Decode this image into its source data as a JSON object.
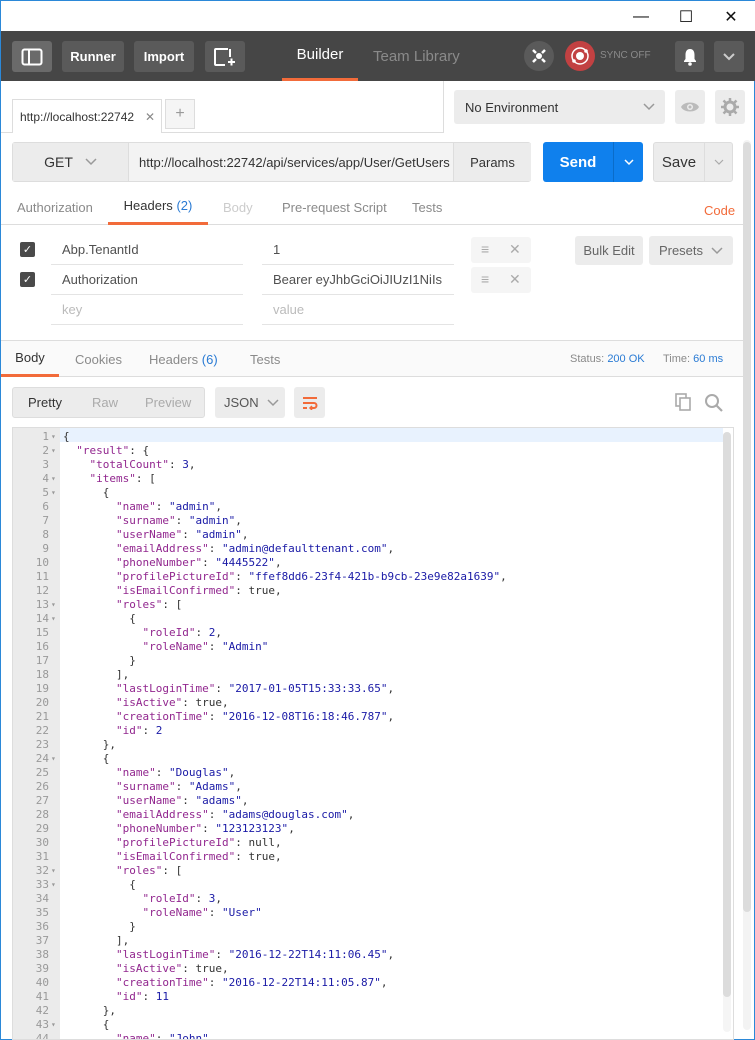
{
  "window": {
    "minimize": "—",
    "maximize": "☐",
    "close": "✕"
  },
  "toolbar": {
    "sidebar_toggle": "sidebar-toggle",
    "runner": "Runner",
    "import": "Import",
    "new_tab": "new-tab",
    "builder": "Builder",
    "team_library": "Team Library",
    "sync_status": "SYNC OFF"
  },
  "request_tabs": {
    "active_tab": "http://localhost:22742",
    "close": "✕",
    "add": "+"
  },
  "environment": {
    "selected": "No Environment"
  },
  "request": {
    "method": "GET",
    "url": "http://localhost:22742/api/services/app/User/GetUsers",
    "params": "Params",
    "send": "Send",
    "save": "Save"
  },
  "subtabs": {
    "authorization": "Authorization",
    "headers": "Headers",
    "headers_count": "(2)",
    "body": "Body",
    "prerequest": "Pre-request Script",
    "tests": "Tests",
    "code": "Code"
  },
  "headers": [
    {
      "checked": true,
      "key": "Abp.TenantId",
      "value": "1"
    },
    {
      "checked": true,
      "key": "Authorization",
      "value": "Bearer eyJhbGciOiJIUzI1NiIs"
    }
  ],
  "header_placeholders": {
    "key": "key",
    "value": "value"
  },
  "header_buttons": {
    "bulk_edit": "Bulk Edit",
    "presets": "Presets"
  },
  "response_tabs": {
    "body": "Body",
    "cookies": "Cookies",
    "headers": "Headers",
    "headers_count": "(6)",
    "tests": "Tests",
    "status_label": "Status:",
    "status_value": "200 OK",
    "time_label": "Time:",
    "time_value": "60 ms"
  },
  "view": {
    "pretty": "Pretty",
    "raw": "Raw",
    "preview": "Preview",
    "format": "JSON"
  },
  "code_lines": [
    {
      "n": "1",
      "f": true,
      "i": 0,
      "t": [
        [
          "p",
          "{"
        ]
      ]
    },
    {
      "n": "2",
      "f": true,
      "i": 1,
      "t": [
        [
          "k",
          "\"result\""
        ],
        [
          "p",
          ": {"
        ]
      ]
    },
    {
      "n": "3",
      "f": false,
      "i": 2,
      "t": [
        [
          "k",
          "\"totalCount\""
        ],
        [
          "p",
          ": "
        ],
        [
          "n",
          "3"
        ],
        [
          "p",
          ","
        ]
      ]
    },
    {
      "n": "4",
      "f": true,
      "i": 2,
      "t": [
        [
          "k",
          "\"items\""
        ],
        [
          "p",
          ": ["
        ]
      ]
    },
    {
      "n": "5",
      "f": true,
      "i": 3,
      "t": [
        [
          "p",
          "{"
        ]
      ]
    },
    {
      "n": "6",
      "f": false,
      "i": 4,
      "t": [
        [
          "k",
          "\"name\""
        ],
        [
          "p",
          ": "
        ],
        [
          "s",
          "\"admin\""
        ],
        [
          "p",
          ","
        ]
      ]
    },
    {
      "n": "7",
      "f": false,
      "i": 4,
      "t": [
        [
          "k",
          "\"surname\""
        ],
        [
          "p",
          ": "
        ],
        [
          "s",
          "\"admin\""
        ],
        [
          "p",
          ","
        ]
      ]
    },
    {
      "n": "8",
      "f": false,
      "i": 4,
      "t": [
        [
          "k",
          "\"userName\""
        ],
        [
          "p",
          ": "
        ],
        [
          "s",
          "\"admin\""
        ],
        [
          "p",
          ","
        ]
      ]
    },
    {
      "n": "9",
      "f": false,
      "i": 4,
      "t": [
        [
          "k",
          "\"emailAddress\""
        ],
        [
          "p",
          ": "
        ],
        [
          "s",
          "\"admin@defaulttenant.com\""
        ],
        [
          "p",
          ","
        ]
      ]
    },
    {
      "n": "10",
      "f": false,
      "i": 4,
      "t": [
        [
          "k",
          "\"phoneNumber\""
        ],
        [
          "p",
          ": "
        ],
        [
          "s",
          "\"4445522\""
        ],
        [
          "p",
          ","
        ]
      ]
    },
    {
      "n": "11",
      "f": false,
      "i": 4,
      "t": [
        [
          "k",
          "\"profilePictureId\""
        ],
        [
          "p",
          ": "
        ],
        [
          "s",
          "\"ffef8dd6-23f4-421b-b9cb-23e9e82a1639\""
        ],
        [
          "p",
          ","
        ]
      ]
    },
    {
      "n": "12",
      "f": false,
      "i": 4,
      "t": [
        [
          "k",
          "\"isEmailConfirmed\""
        ],
        [
          "p",
          ": true,"
        ]
      ]
    },
    {
      "n": "13",
      "f": true,
      "i": 4,
      "t": [
        [
          "k",
          "\"roles\""
        ],
        [
          "p",
          ": ["
        ]
      ]
    },
    {
      "n": "14",
      "f": true,
      "i": 5,
      "t": [
        [
          "p",
          "{"
        ]
      ]
    },
    {
      "n": "15",
      "f": false,
      "i": 6,
      "t": [
        [
          "k",
          "\"roleId\""
        ],
        [
          "p",
          ": "
        ],
        [
          "n",
          "2"
        ],
        [
          "p",
          ","
        ]
      ]
    },
    {
      "n": "16",
      "f": false,
      "i": 6,
      "t": [
        [
          "k",
          "\"roleName\""
        ],
        [
          "p",
          ": "
        ],
        [
          "s",
          "\"Admin\""
        ]
      ]
    },
    {
      "n": "17",
      "f": false,
      "i": 5,
      "t": [
        [
          "p",
          "}"
        ]
      ]
    },
    {
      "n": "18",
      "f": false,
      "i": 4,
      "t": [
        [
          "p",
          "],"
        ]
      ]
    },
    {
      "n": "19",
      "f": false,
      "i": 4,
      "t": [
        [
          "k",
          "\"lastLoginTime\""
        ],
        [
          "p",
          ": "
        ],
        [
          "s",
          "\"2017-01-05T15:33:33.65\""
        ],
        [
          "p",
          ","
        ]
      ]
    },
    {
      "n": "20",
      "f": false,
      "i": 4,
      "t": [
        [
          "k",
          "\"isActive\""
        ],
        [
          "p",
          ": true,"
        ]
      ]
    },
    {
      "n": "21",
      "f": false,
      "i": 4,
      "t": [
        [
          "k",
          "\"creationTime\""
        ],
        [
          "p",
          ": "
        ],
        [
          "s",
          "\"2016-12-08T16:18:46.787\""
        ],
        [
          "p",
          ","
        ]
      ]
    },
    {
      "n": "22",
      "f": false,
      "i": 4,
      "t": [
        [
          "k",
          "\"id\""
        ],
        [
          "p",
          ": "
        ],
        [
          "n",
          "2"
        ]
      ]
    },
    {
      "n": "23",
      "f": false,
      "i": 3,
      "t": [
        [
          "p",
          "},"
        ]
      ]
    },
    {
      "n": "24",
      "f": true,
      "i": 3,
      "t": [
        [
          "p",
          "{"
        ]
      ]
    },
    {
      "n": "25",
      "f": false,
      "i": 4,
      "t": [
        [
          "k",
          "\"name\""
        ],
        [
          "p",
          ": "
        ],
        [
          "s",
          "\"Douglas\""
        ],
        [
          "p",
          ","
        ]
      ]
    },
    {
      "n": "26",
      "f": false,
      "i": 4,
      "t": [
        [
          "k",
          "\"surname\""
        ],
        [
          "p",
          ": "
        ],
        [
          "s",
          "\"Adams\""
        ],
        [
          "p",
          ","
        ]
      ]
    },
    {
      "n": "27",
      "f": false,
      "i": 4,
      "t": [
        [
          "k",
          "\"userName\""
        ],
        [
          "p",
          ": "
        ],
        [
          "s",
          "\"adams\""
        ],
        [
          "p",
          ","
        ]
      ]
    },
    {
      "n": "28",
      "f": false,
      "i": 4,
      "t": [
        [
          "k",
          "\"emailAddress\""
        ],
        [
          "p",
          ": "
        ],
        [
          "s",
          "\"adams@douglas.com\""
        ],
        [
          "p",
          ","
        ]
      ]
    },
    {
      "n": "29",
      "f": false,
      "i": 4,
      "t": [
        [
          "k",
          "\"phoneNumber\""
        ],
        [
          "p",
          ": "
        ],
        [
          "s",
          "\"123123123\""
        ],
        [
          "p",
          ","
        ]
      ]
    },
    {
      "n": "30",
      "f": false,
      "i": 4,
      "t": [
        [
          "k",
          "\"profilePictureId\""
        ],
        [
          "p",
          ": null,"
        ]
      ]
    },
    {
      "n": "31",
      "f": false,
      "i": 4,
      "t": [
        [
          "k",
          "\"isEmailConfirmed\""
        ],
        [
          "p",
          ": true,"
        ]
      ]
    },
    {
      "n": "32",
      "f": true,
      "i": 4,
      "t": [
        [
          "k",
          "\"roles\""
        ],
        [
          "p",
          ": ["
        ]
      ]
    },
    {
      "n": "33",
      "f": true,
      "i": 5,
      "t": [
        [
          "p",
          "{"
        ]
      ]
    },
    {
      "n": "34",
      "f": false,
      "i": 6,
      "t": [
        [
          "k",
          "\"roleId\""
        ],
        [
          "p",
          ": "
        ],
        [
          "n",
          "3"
        ],
        [
          "p",
          ","
        ]
      ]
    },
    {
      "n": "35",
      "f": false,
      "i": 6,
      "t": [
        [
          "k",
          "\"roleName\""
        ],
        [
          "p",
          ": "
        ],
        [
          "s",
          "\"User\""
        ]
      ]
    },
    {
      "n": "36",
      "f": false,
      "i": 5,
      "t": [
        [
          "p",
          "}"
        ]
      ]
    },
    {
      "n": "37",
      "f": false,
      "i": 4,
      "t": [
        [
          "p",
          "],"
        ]
      ]
    },
    {
      "n": "38",
      "f": false,
      "i": 4,
      "t": [
        [
          "k",
          "\"lastLoginTime\""
        ],
        [
          "p",
          ": "
        ],
        [
          "s",
          "\"2016-12-22T14:11:06.45\""
        ],
        [
          "p",
          ","
        ]
      ]
    },
    {
      "n": "39",
      "f": false,
      "i": 4,
      "t": [
        [
          "k",
          "\"isActive\""
        ],
        [
          "p",
          ": true,"
        ]
      ]
    },
    {
      "n": "40",
      "f": false,
      "i": 4,
      "t": [
        [
          "k",
          "\"creationTime\""
        ],
        [
          "p",
          ": "
        ],
        [
          "s",
          "\"2016-12-22T14:11:05.87\""
        ],
        [
          "p",
          ","
        ]
      ]
    },
    {
      "n": "41",
      "f": false,
      "i": 4,
      "t": [
        [
          "k",
          "\"id\""
        ],
        [
          "p",
          ": "
        ],
        [
          "n",
          "11"
        ]
      ]
    },
    {
      "n": "42",
      "f": false,
      "i": 3,
      "t": [
        [
          "p",
          "},"
        ]
      ]
    },
    {
      "n": "43",
      "f": true,
      "i": 3,
      "t": [
        [
          "p",
          "{"
        ]
      ]
    },
    {
      "n": "44",
      "f": false,
      "i": 4,
      "t": [
        [
          "k",
          "\"name\""
        ],
        [
          "p",
          ": "
        ],
        [
          "s",
          "\"John\""
        ]
      ]
    }
  ]
}
